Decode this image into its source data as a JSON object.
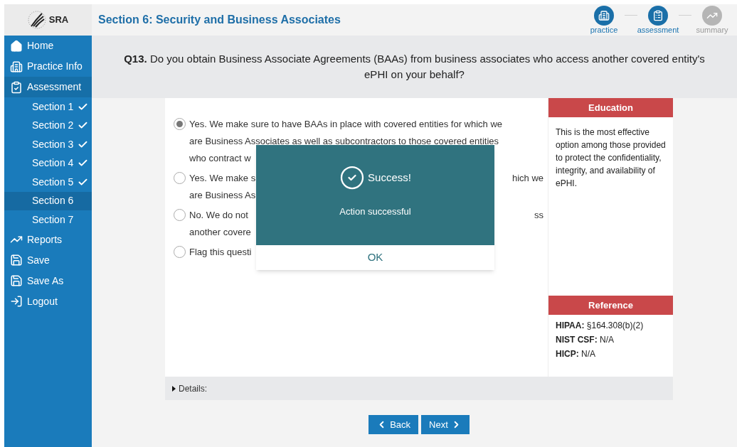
{
  "header": {
    "logo_text": "SRA",
    "title": "Section 6: Security and Business Associates",
    "steps": [
      {
        "kind": "practice",
        "label": "practice",
        "active": true
      },
      {
        "kind": "assessment",
        "label": "assessment",
        "active": true
      },
      {
        "kind": "summary",
        "label": "summary",
        "active": false
      }
    ]
  },
  "sidebar": {
    "items": [
      {
        "kind": "home",
        "label": "Home",
        "selected": false
      },
      {
        "kind": "practice",
        "label": "Practice Info",
        "selected": false
      },
      {
        "kind": "assessment",
        "label": "Assessment",
        "selected": true
      },
      {
        "kind": "section",
        "label": "Section 1",
        "done": true,
        "selected": false
      },
      {
        "kind": "section",
        "label": "Section 2",
        "done": true,
        "selected": false
      },
      {
        "kind": "section",
        "label": "Section 3",
        "done": true,
        "selected": false
      },
      {
        "kind": "section",
        "label": "Section 4",
        "done": true,
        "selected": false
      },
      {
        "kind": "section",
        "label": "Section 5",
        "done": true,
        "selected": false
      },
      {
        "kind": "section",
        "label": "Section 6",
        "done": false,
        "selected": true
      },
      {
        "kind": "section",
        "label": "Section 7",
        "done": false,
        "selected": false
      },
      {
        "kind": "reports",
        "label": "Reports",
        "selected": false
      },
      {
        "kind": "save",
        "label": "Save",
        "selected": false
      },
      {
        "kind": "save",
        "label": "Save As",
        "selected": false
      },
      {
        "kind": "logout",
        "label": "Logout",
        "selected": false
      }
    ]
  },
  "question": "**Q13.** Do you obtain Business Associate Agreements (BAAs) from business associates who access another covered entity's ePHI on your behalf?",
  "options": [
    {
      "selected": true,
      "lines": [
        {
          "left": "Yes. We make sure to have BAAs in place with covered entities for which we"
        },
        {
          "left": "are Business Associates as well as subcontractors to those covered entities"
        },
        {
          "left": "who contract w"
        }
      ]
    },
    {
      "selected": false,
      "lines": [
        {
          "left": "Yes. We make s",
          "right": "hich we"
        },
        {
          "left": "are Business As"
        }
      ]
    },
    {
      "selected": false,
      "lines": [
        {
          "left": "No. We do not",
          "right": "ss"
        },
        {
          "left": "another covere"
        }
      ]
    },
    {
      "selected": false,
      "lines": [
        {
          "left": "Flag this questi"
        }
      ]
    }
  ],
  "education": {
    "title": "Education",
    "text": "This is the most effective option among those provided to protect the confidentiality, integrity, and availability of ePHI."
  },
  "reference": {
    "title": "Reference",
    "entries": [
      {
        "label": "HIPAA:",
        "value": "§164.308(b)(2)"
      },
      {
        "label": "NIST CSF:",
        "value": "N/A"
      },
      {
        "label": "HICP:",
        "value": "N/A"
      }
    ]
  },
  "details": {
    "label": "Details:",
    "expanded": false
  },
  "buttons": [
    {
      "kind": "back",
      "label": "Back"
    },
    {
      "kind": "next",
      "label": "Next"
    }
  ],
  "dialog": {
    "title": "Success!",
    "message": "Action successful",
    "button": "OK"
  }
}
